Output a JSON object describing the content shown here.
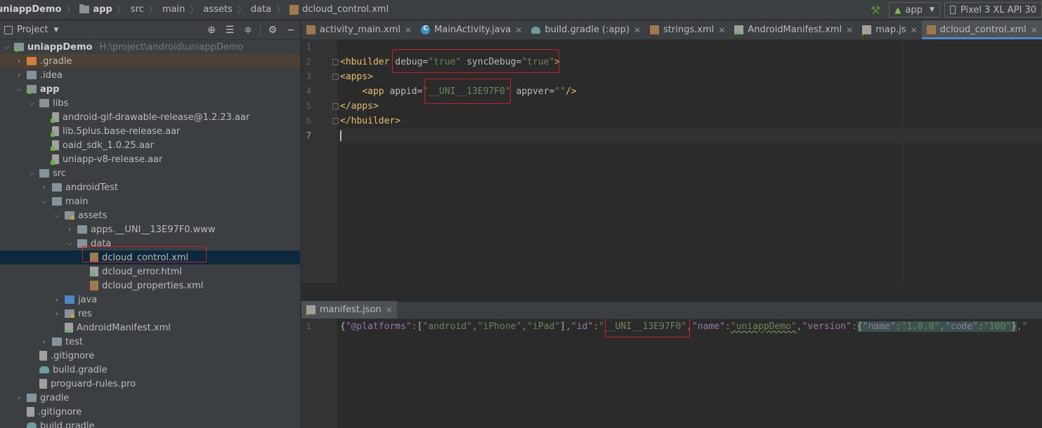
{
  "breadcrumb": {
    "items": [
      "uniappDemo",
      "app",
      "src",
      "main",
      "assets",
      "data",
      "dcloud_control.xml"
    ]
  },
  "toolbar": {
    "run_config": "app",
    "device": "Pixel 3 XL API 30"
  },
  "project": {
    "title": "Project",
    "tree": [
      {
        "label": "uniappDemo",
        "hint": "H:\\project\\android\\uniappDemo"
      },
      {
        "label": ".gradle"
      },
      {
        "label": ".idea"
      },
      {
        "label": "app"
      },
      {
        "label": "libs"
      },
      {
        "label": "android-gif-drawable-release@1.2.23.aar"
      },
      {
        "label": "lib.5plus.base-release.aar"
      },
      {
        "label": "oaid_sdk_1.0.25.aar"
      },
      {
        "label": "uniapp-v8-release.aar"
      },
      {
        "label": "src"
      },
      {
        "label": "androidTest"
      },
      {
        "label": "main"
      },
      {
        "label": "assets"
      },
      {
        "label": "apps.__UNI__13E97F0.www"
      },
      {
        "label": "data"
      },
      {
        "label": "dcloud_control.xml"
      },
      {
        "label": "dcloud_error.html"
      },
      {
        "label": "dcloud_properties.xml"
      },
      {
        "label": "java"
      },
      {
        "label": "res"
      },
      {
        "label": "AndroidManifest.xml"
      },
      {
        "label": "test"
      },
      {
        "label": ".gitignore"
      },
      {
        "label": "build.gradle"
      },
      {
        "label": "proguard-rules.pro"
      },
      {
        "label": "gradle"
      },
      {
        "label": ".gitignore"
      },
      {
        "label": "build.gradle"
      }
    ]
  },
  "tabs": [
    {
      "label": "activity_main.xml",
      "icon": "xml-icon"
    },
    {
      "label": "MainActivity.java",
      "icon": "java-class-icon"
    },
    {
      "label": "build.gradle (:app)",
      "icon": "gradle-icon"
    },
    {
      "label": "strings.xml",
      "icon": "xml-icon"
    },
    {
      "label": "AndroidManifest.xml",
      "icon": "manifest-icon"
    },
    {
      "label": "map.js",
      "icon": "js-icon"
    },
    {
      "label": "dcloud_control.xml",
      "icon": "xml-icon",
      "active": true
    }
  ],
  "editor": {
    "line_numbers": [
      "1",
      "2",
      "3",
      "4",
      "5",
      "6",
      "7"
    ],
    "code": {
      "l2_tag_open": "<hbuilder",
      "l2_attr1": "debug",
      "l2_val1": "\"true\"",
      "l2_attr2": "syncDebug",
      "l2_val2": "\"true\"",
      "l2_close": ">",
      "l3": "<apps>",
      "l4_tag": "<app",
      "l4_attr1": "appid",
      "l4_val1": "\"__UNI__13E97F0\"",
      "l4_attr2": "appver",
      "l4_val2": "\"\"",
      "l4_close": "/>",
      "l5": "</apps>",
      "l6": "</hbuilder>"
    }
  },
  "editor2": {
    "tab": "manifest.json",
    "line_number": "1",
    "json": {
      "k_platforms": "\"@platforms\"",
      "v_android": "\"android\"",
      "v_iphone": "\"iPhone\"",
      "v_ipad": "\"iPad\"",
      "k_id": "\"id\"",
      "v_id": "\"__UNI__13E97F0\"",
      "k_name": "\"name\"",
      "v_name": "\"uniappDemo\"",
      "k_version": "\"version\"",
      "k_vname": "\"name\"",
      "v_vname": "\"1.0.0\"",
      "k_code": "\"code\"",
      "v_code": "\"100\"",
      "tail": "\""
    }
  }
}
